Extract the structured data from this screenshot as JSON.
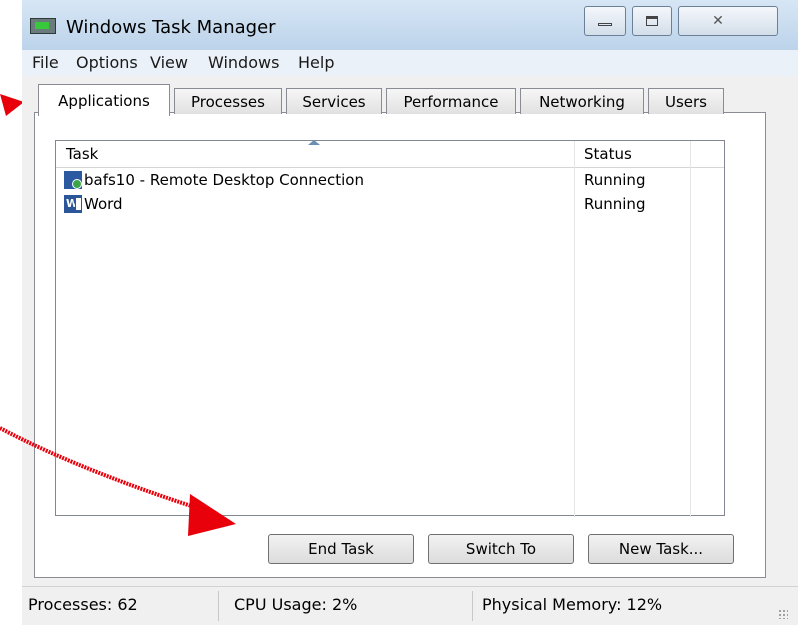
{
  "window": {
    "title": "Windows Task Manager"
  },
  "menu": [
    "File",
    "Options",
    "View",
    "Windows",
    "Help"
  ],
  "tabs": [
    "Applications",
    "Processes",
    "Services",
    "Performance",
    "Networking",
    "Users"
  ],
  "active_tab": "Applications",
  "table": {
    "columns": [
      "Task",
      "Status"
    ],
    "rows": [
      {
        "task": "bafs10 - Remote Desktop Connection",
        "status": "Running",
        "icon": "remote-desktop-icon"
      },
      {
        "task": "Word",
        "status": "Running",
        "icon": "word-icon"
      }
    ]
  },
  "buttons": {
    "end_task": "End Task",
    "switch_to": "Switch To",
    "new_task": "New Task..."
  },
  "status_bar": {
    "processes": "Processes: 62",
    "cpu": "CPU Usage: 2%",
    "memory": "Physical Memory: 12%"
  },
  "colors": {
    "annotation_arrow": "#e8000b",
    "frame": "#bcd3ea"
  }
}
